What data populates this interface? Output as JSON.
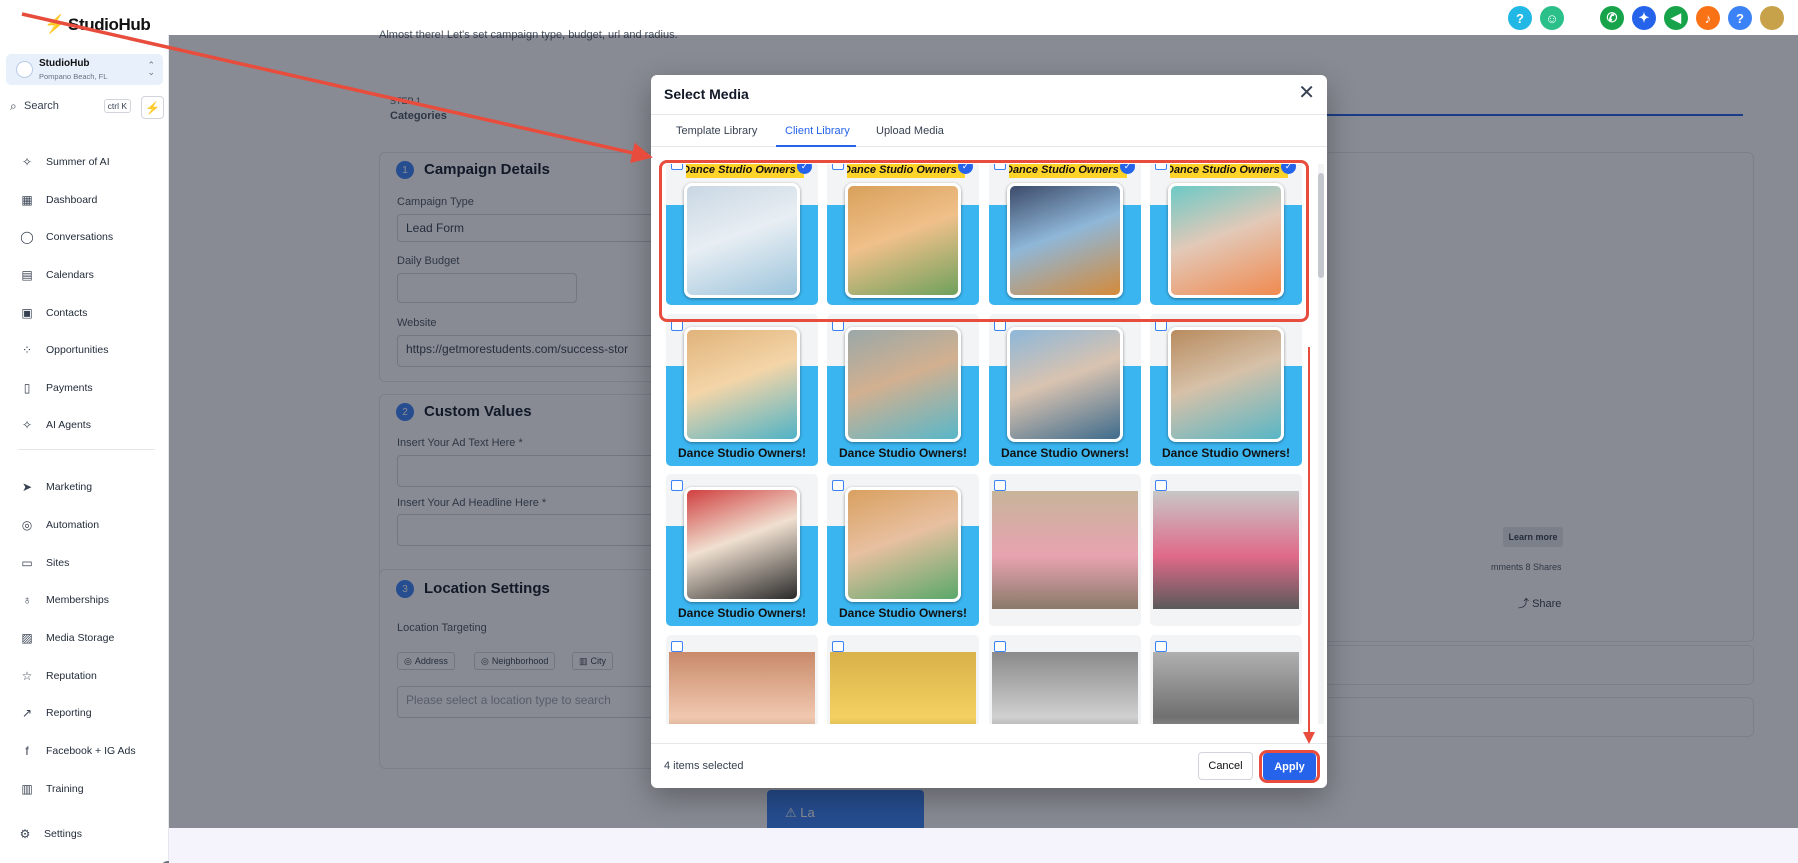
{
  "topbar": {
    "logo_text": "StudioHub",
    "icons": [
      {
        "name": "help-icon",
        "glyph": "?",
        "color": "#22b8e6"
      },
      {
        "name": "bot-icon",
        "glyph": "☺",
        "color": "#2bbf8a"
      },
      {
        "name": "phone-icon",
        "glyph": "✆",
        "color": "#16a34a"
      },
      {
        "name": "sparkle-icon",
        "glyph": "✦",
        "color": "#2563eb"
      },
      {
        "name": "megaphone-icon",
        "glyph": "◀",
        "color": "#16a34a"
      },
      {
        "name": "bell-icon",
        "glyph": "♪",
        "color": "#f97316"
      },
      {
        "name": "question-icon",
        "glyph": "?",
        "color": "#3b82f6"
      },
      {
        "name": "user-avatar-icon",
        "glyph": "",
        "color": "#c8a24a"
      }
    ]
  },
  "sidebar": {
    "location_name": "StudioHub",
    "location_sub": "Pompano Beach, FL",
    "search_label": "Search",
    "search_shortcut": "ctrl K",
    "items": [
      {
        "label": "Summer of AI",
        "icon": "✧"
      },
      {
        "label": "Dashboard",
        "icon": "▦"
      },
      {
        "label": "Conversations",
        "icon": "◯"
      },
      {
        "label": "Calendars",
        "icon": "▤"
      },
      {
        "label": "Contacts",
        "icon": "▣"
      },
      {
        "label": "Opportunities",
        "icon": "⁘"
      },
      {
        "label": "Payments",
        "icon": "▯"
      },
      {
        "label": "AI Agents",
        "icon": "✧"
      },
      {
        "label": "Marketing",
        "icon": "➤"
      },
      {
        "label": "Automation",
        "icon": "◎"
      },
      {
        "label": "Sites",
        "icon": "▭"
      },
      {
        "label": "Memberships",
        "icon": "♁"
      },
      {
        "label": "Media Storage",
        "icon": "▨"
      },
      {
        "label": "Reputation",
        "icon": "☆"
      },
      {
        "label": "Reporting",
        "icon": "↗"
      },
      {
        "label": "Facebook + IG Ads",
        "icon": "f"
      },
      {
        "label": "Training",
        "icon": "▥"
      }
    ],
    "settings_label": "Settings"
  },
  "background": {
    "intro_text": "Almost there! Let's set campaign type, budget, url and radius.",
    "step_label": "STEP 1",
    "step_name": "Categories",
    "section1_num": "1",
    "section1_title": "Campaign Details",
    "campaign_type_label": "Campaign Type",
    "campaign_type_value": "Lead Form",
    "daily_budget_label": "Daily Budget",
    "website_label": "Website",
    "website_value": "https://getmorestudents.com/success-stor",
    "section2_num": "2",
    "section2_title": "Custom Values",
    "ad_text_label": "Insert Your Ad Text Here *",
    "ad_headline_label": "Insert Your Ad Headline Here *",
    "section3_num": "3",
    "section3_title": "Location Settings",
    "location_targeting_label": "Location Targeting",
    "chips": [
      "Address",
      "Neighborhood",
      "City"
    ],
    "location_placeholder": "Please select a location type to search",
    "learn_more": "Learn more",
    "comments_shares": "mments 8 Shares",
    "share_label": "Share",
    "launch_label": "La"
  },
  "modal": {
    "title": "Select Media",
    "tabs": [
      "Template Library",
      "Client Library",
      "Upload Media"
    ],
    "active_tab": "Client Library",
    "caption": "Dance Studio Owners!",
    "banner": "Dance Studio Owners",
    "selected_count_text": "4 items selected",
    "cancel_label": "Cancel",
    "apply_label": "Apply"
  },
  "colors": {
    "accent": "#2563eb",
    "tile_blue": "#3bb5f0",
    "annotation_red": "#e74c3c",
    "banner_yellow": "#ffd42a"
  }
}
